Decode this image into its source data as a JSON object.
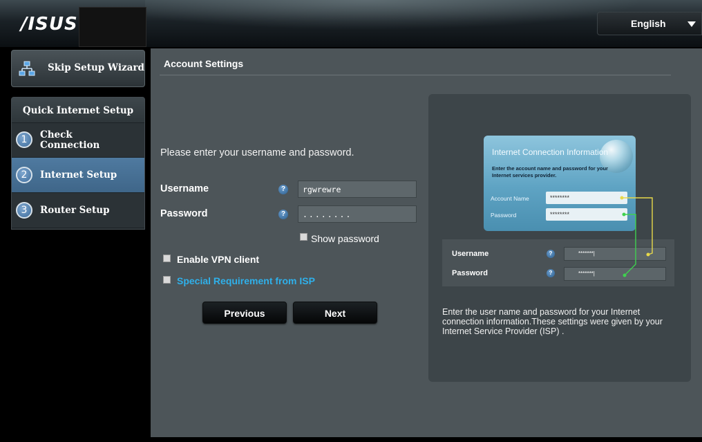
{
  "header": {
    "logo_text": "/ISUS",
    "language": {
      "selected": "English"
    }
  },
  "sidebar": {
    "skip_label": "Skip Setup Wizard",
    "wizard_title": "Quick Internet Setup",
    "steps": [
      {
        "number": "1",
        "label": "Check Connection",
        "active": false
      },
      {
        "number": "2",
        "label": "Internet Setup",
        "active": true
      },
      {
        "number": "3",
        "label": "Router Setup",
        "active": false
      }
    ]
  },
  "main": {
    "title": "Account Settings",
    "prompt": "Please enter your username and password.",
    "username": {
      "label": "Username",
      "value": "rgwrewre",
      "help": "?"
    },
    "password": {
      "label": "Password",
      "value": "........",
      "help": "?"
    },
    "show_password_label": "Show password",
    "vpn_label": "Enable VPN client",
    "isp_link": "Special Requirement from ISP",
    "previous_label": "Previous",
    "next_label": "Next"
  },
  "info": {
    "card": {
      "title": "Internet Connection Information",
      "desc": "Enter the account name and password for your Internet services provider.",
      "account_label": "Account Name",
      "account_value": "********",
      "password_label": "Password",
      "password_value": "********"
    },
    "mini_form": {
      "username_label": "Username",
      "password_label": "Password",
      "help": "?",
      "username_value": "*******|",
      "password_value": "*******|"
    },
    "description": "Enter the user name and password for your Internet connection information.These settings were given by your Internet Service Provider (ISP) ."
  },
  "colors": {
    "accent_blue": "#4f7aa0",
    "link_blue": "#2fb0ea",
    "panel_bg": "#4d5559",
    "connector_yellow": "#e8d94a",
    "connector_green": "#3fd14f"
  }
}
